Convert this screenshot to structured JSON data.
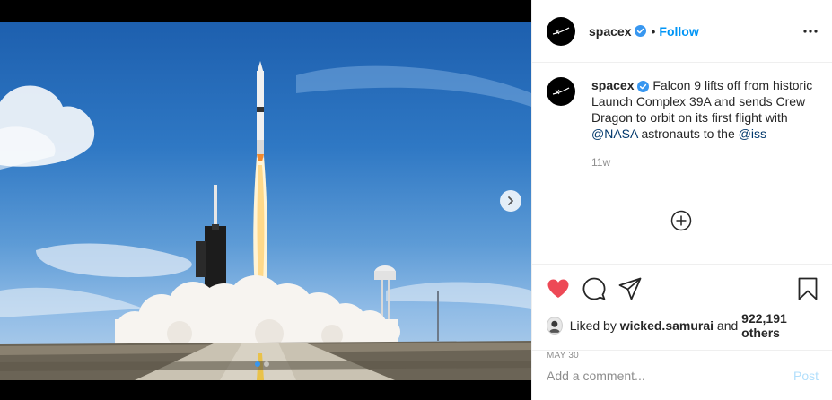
{
  "account": {
    "username": "spacex",
    "separator": "•",
    "follow_label": "Follow"
  },
  "caption": {
    "username": "spacex",
    "text_before": " Falcon 9 lifts off from historic Launch Complex 39A and sends Crew Dragon to orbit on its first flight with ",
    "mention_1": "@NASA",
    "text_middle": " astronauts to the ",
    "mention_2": "@iss",
    "time_ago": "11w"
  },
  "likes": {
    "prefix": "Liked by ",
    "top_liker": "wicked.samurai",
    "connector": " and ",
    "others": "922,191 others"
  },
  "date": "MAY 30",
  "comment": {
    "placeholder": "Add a comment...",
    "post_label": "Post"
  },
  "carousel": {
    "slides": 2,
    "active_slide": 1
  },
  "icons": {
    "verified": "verified-badge-icon",
    "more": "more-options-icon",
    "like": "heart-icon",
    "comment": "comment-icon",
    "share": "share-icon",
    "save": "bookmark-icon",
    "next": "chevron-right-icon",
    "add": "plus-circle-icon"
  },
  "colors": {
    "like": "#ed4956",
    "link": "#0095f6",
    "mention": "#00376b",
    "muted": "#8e8e8e",
    "post_disabled": "#b2dffc"
  }
}
